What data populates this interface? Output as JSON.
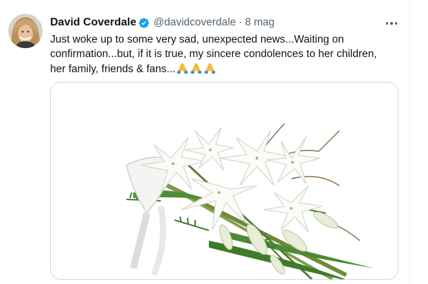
{
  "tweet": {
    "author_name": "David Coverdale",
    "author_handle": "@davidcoverdale",
    "separator": "·",
    "date": "8 mag",
    "text_lines": [
      "Just woke up to some very sad, unexpected news...Waiting on",
      "confirmation...but, if it is true, my sincere condolences to her children,",
      "her family, friends & fans..."
    ],
    "emoji": [
      "folded-hands",
      "folded-hands",
      "folded-hands"
    ],
    "verified_badge_color": "#1d9bf0"
  },
  "icons": {
    "verified": "verified-badge-icon",
    "more": "more-options-icon"
  },
  "media": {
    "subject": "white-lily-funeral-bouquet"
  }
}
